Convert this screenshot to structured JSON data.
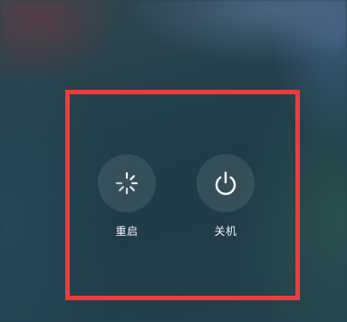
{
  "power_menu": {
    "options": [
      {
        "label": "重启",
        "icon": "restart-spinner-icon"
      },
      {
        "label": "关机",
        "icon": "power-icon"
      }
    ]
  },
  "colors": {
    "highlight_frame": "#f03a3a",
    "label_text": "#f2f4f5",
    "icon_stroke": "#ffffff"
  }
}
